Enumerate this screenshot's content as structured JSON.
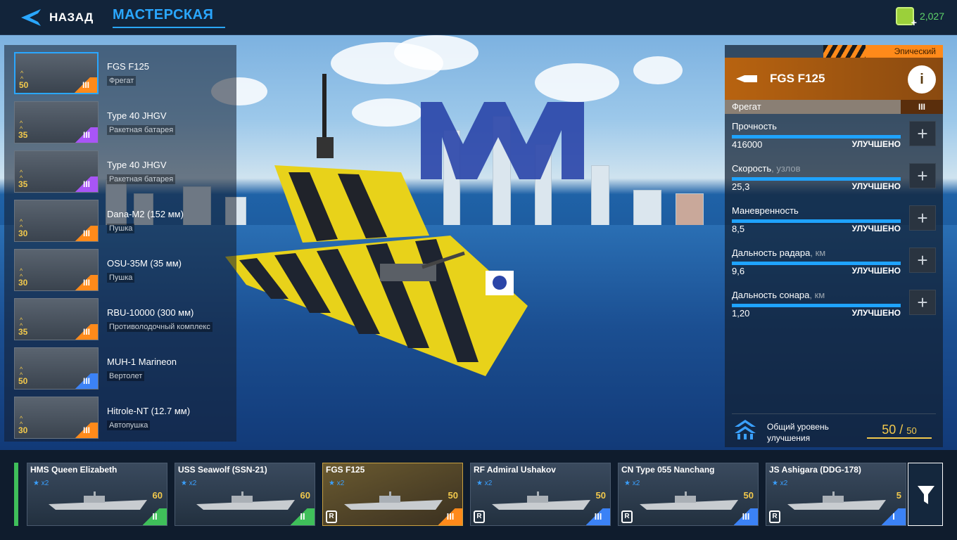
{
  "topbar": {
    "back_label": "НАЗАД",
    "tab_label": "МАСТЕРСКАЯ",
    "currency_value": "2,027"
  },
  "modules": [
    {
      "name": "FGS F125",
      "type": "Фрегат",
      "level": "50",
      "tier": "III",
      "tier_color": "orange",
      "selected": true
    },
    {
      "name": "Type 40 JHGV",
      "type": "Ракетная батарея",
      "level": "35",
      "tier": "III",
      "tier_color": "purple"
    },
    {
      "name": "Type 40 JHGV",
      "type": "Ракетная батарея",
      "level": "35",
      "tier": "III",
      "tier_color": "purple"
    },
    {
      "name": "Dana-M2 (152 мм)",
      "type": "Пушка",
      "level": "30",
      "tier": "III",
      "tier_color": "orange"
    },
    {
      "name": "OSU-35M (35 мм)",
      "type": "Пушка",
      "level": "30",
      "tier": "III",
      "tier_color": "orange"
    },
    {
      "name": "RBU-10000 (300 мм)",
      "type": "Противолодочный комплекс",
      "level": "35",
      "tier": "III",
      "tier_color": "orange"
    },
    {
      "name": "MUH-1 Marineon",
      "type": "Вертолет",
      "level": "50",
      "tier": "III",
      "tier_color": "blue"
    },
    {
      "name": "Hitrole-NT (12.7 мм)",
      "type": "Автопушка",
      "level": "30",
      "tier": "III",
      "tier_color": "orange"
    }
  ],
  "panel": {
    "rarity": "Эпический",
    "ship_name": "FGS F125",
    "info_icon": "i",
    "class": "Фрегат",
    "tier": "III",
    "stats": [
      {
        "label": "Прочность",
        "unit": "",
        "value": "416000",
        "state": "УЛУЧШЕНО"
      },
      {
        "label": "Скорость",
        "unit": ", узлов",
        "value": "25,3",
        "state": "УЛУЧШЕНО"
      },
      {
        "label": "Маневренность",
        "unit": "",
        "value": "8,5",
        "state": "УЛУЧШЕНО"
      },
      {
        "label": "Дальность радара",
        "unit": ", км",
        "value": "9,6",
        "state": "УЛУЧШЕНО"
      },
      {
        "label": "Дальность сонара",
        "unit": ", км",
        "value": "1,20",
        "state": "УЛУЧШЕНО"
      }
    ],
    "total_label_1": "Общий уровень",
    "total_label_2": "улучшения",
    "total_current": "50",
    "total_max": "50"
  },
  "ships": [
    {
      "name": "HMS Queen Elizabeth",
      "badge": "x2",
      "level": "60",
      "tier": "II",
      "tier_color": "green",
      "r": false
    },
    {
      "name": "USS Seawolf (SSN-21)",
      "badge": "x2",
      "level": "60",
      "tier": "II",
      "tier_color": "green",
      "r": false
    },
    {
      "name": "FGS F125",
      "badge": "x2",
      "level": "50",
      "tier": "III",
      "tier_color": "orange",
      "r": true,
      "selected": true
    },
    {
      "name": "RF Admiral Ushakov",
      "badge": "x2",
      "level": "50",
      "tier": "III",
      "tier_color": "blue",
      "r": true
    },
    {
      "name": "CN Type 055 Nanchang",
      "badge": "x2",
      "level": "50",
      "tier": "III",
      "tier_color": "blue",
      "r": true
    },
    {
      "name": "JS Ashigara (DDG-178)",
      "badge": "x2",
      "level": "5",
      "tier": "I",
      "tier_color": "blue",
      "r": true
    }
  ],
  "r_label": "R",
  "colors": {
    "accent": "#2aa7ff",
    "gold": "#f2c94c",
    "epic": "#ff8a1a",
    "green": "#3fbf5a"
  }
}
